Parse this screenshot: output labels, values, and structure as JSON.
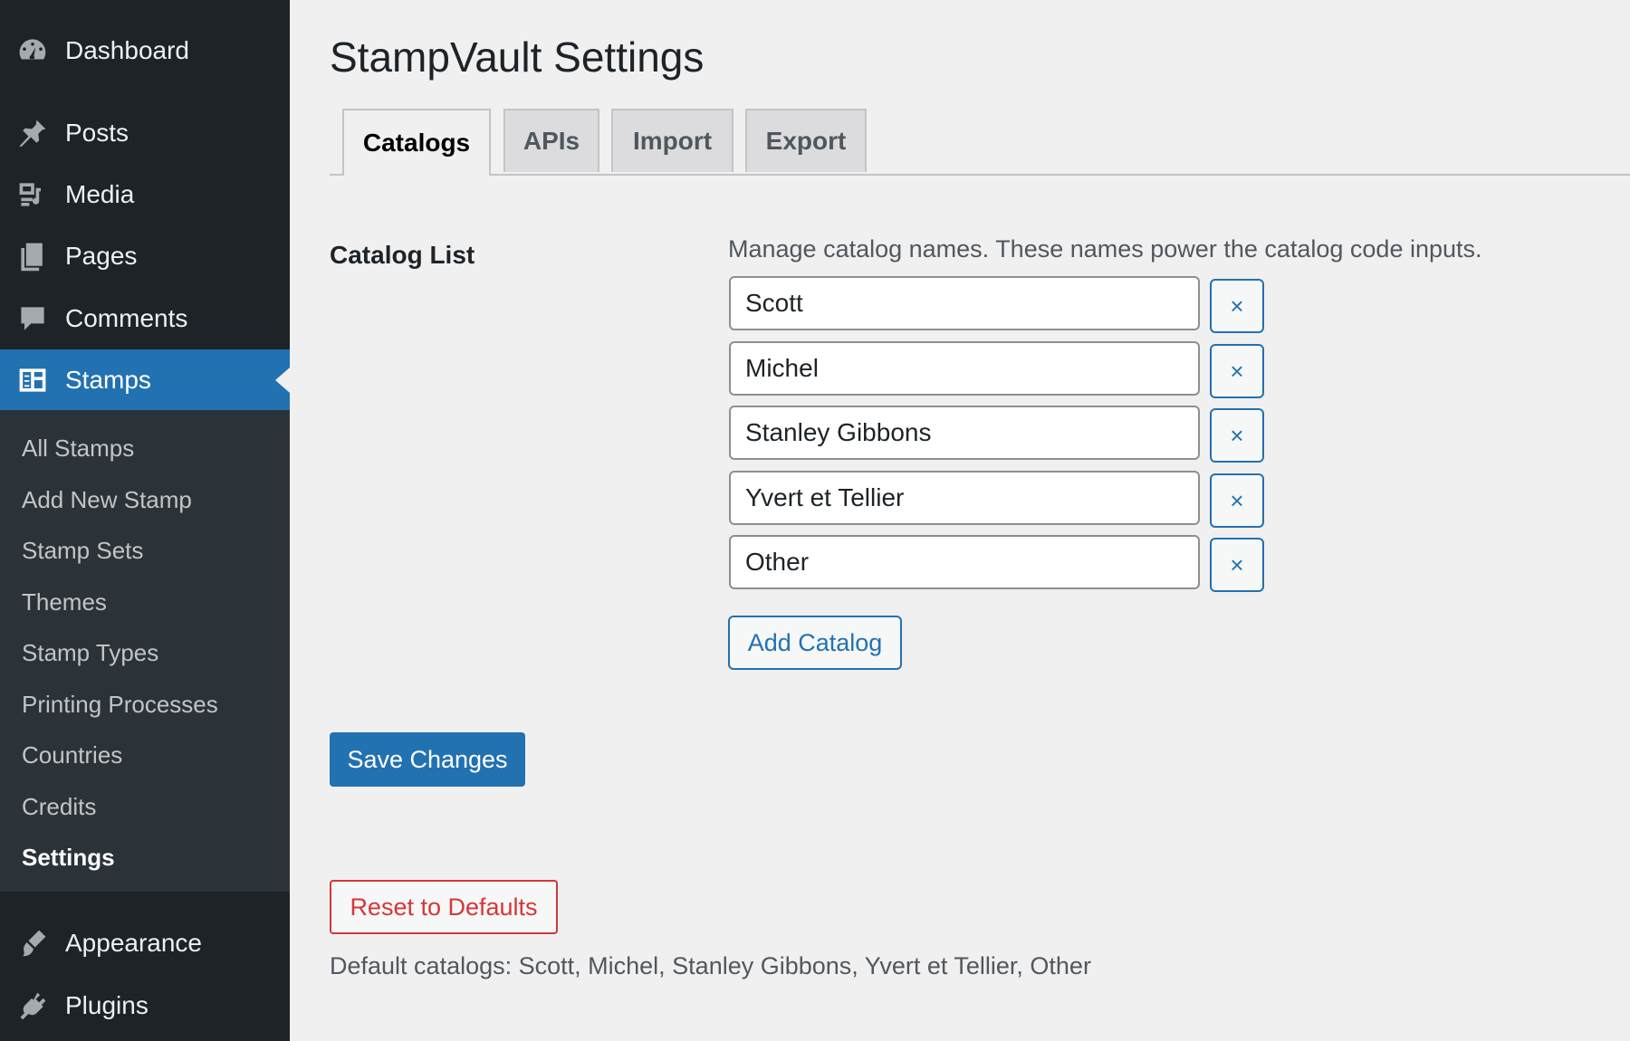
{
  "sidebar": {
    "items": [
      {
        "label": "Dashboard",
        "icon": "dashboard-icon"
      },
      {
        "label": "Posts",
        "icon": "pushpin-icon"
      },
      {
        "label": "Media",
        "icon": "media-icon"
      },
      {
        "label": "Pages",
        "icon": "pages-icon"
      },
      {
        "label": "Comments",
        "icon": "comment-icon"
      },
      {
        "label": "Stamps",
        "icon": "table-icon"
      },
      {
        "label": "Appearance",
        "icon": "paintbrush-icon"
      },
      {
        "label": "Plugins",
        "icon": "plug-icon"
      }
    ],
    "submenu": [
      {
        "label": "All Stamps"
      },
      {
        "label": "Add New Stamp"
      },
      {
        "label": "Stamp Sets"
      },
      {
        "label": "Themes"
      },
      {
        "label": "Stamp Types"
      },
      {
        "label": "Printing Processes"
      },
      {
        "label": "Countries"
      },
      {
        "label": "Credits"
      },
      {
        "label": "Settings"
      }
    ],
    "current_item": "Stamps",
    "current_subitem": "Settings"
  },
  "main": {
    "title": "StampVault Settings",
    "tabs": [
      {
        "label": "Catalogs",
        "active": true
      },
      {
        "label": "APIs",
        "active": false
      },
      {
        "label": "Import",
        "active": false
      },
      {
        "label": "Export",
        "active": false
      }
    ],
    "section_label": "Catalog List",
    "description": "Manage catalog names. These names power the catalog code inputs.",
    "catalogs": [
      "Scott",
      "Michel",
      "Stanley Gibbons",
      "Yvert et Tellier",
      "Other"
    ],
    "remove_label": "×",
    "add_catalog_label": "Add Catalog",
    "save_label": "Save Changes",
    "reset_label": "Reset to Defaults",
    "defaults_note": "Default catalogs: Scott, Michel, Stanley Gibbons, Yvert et Tellier, Other"
  },
  "colors": {
    "sidebar_bg": "#1d2327",
    "submenu_bg": "#2c3338",
    "accent": "#2271b1",
    "danger": "#d63638",
    "page_bg": "#f0f0f1"
  }
}
